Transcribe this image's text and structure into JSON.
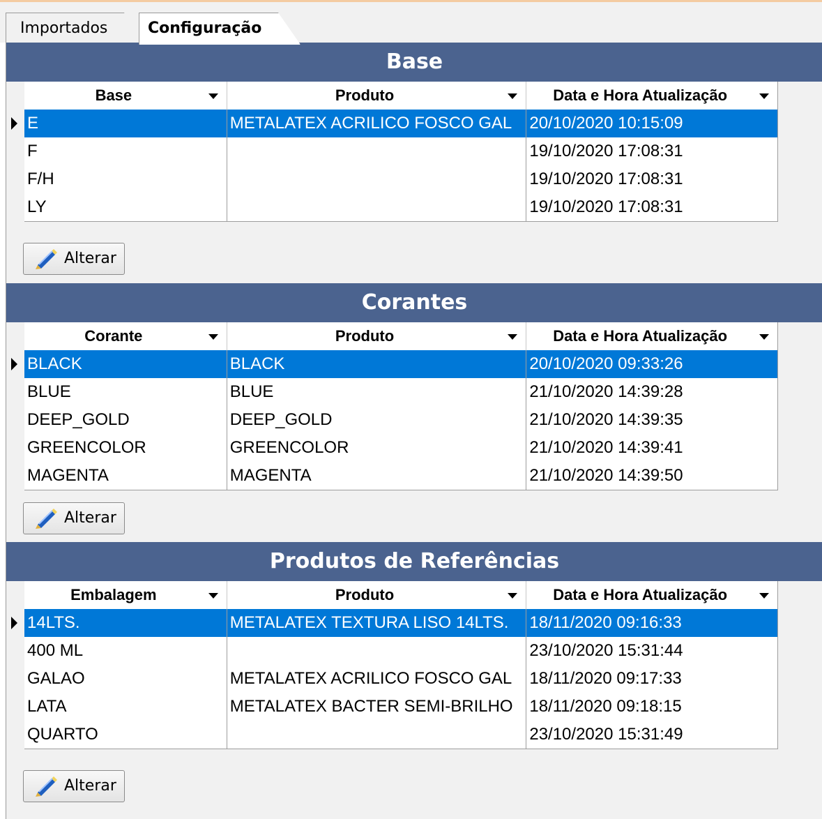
{
  "tabs": [
    {
      "label": "Importados",
      "active": false
    },
    {
      "label": "Configuração",
      "active": true
    }
  ],
  "sections": [
    {
      "title": "Base",
      "columns": [
        "Base",
        "Produto",
        "Data e Hora Atualização"
      ],
      "rows": [
        {
          "c1": "E",
          "c2": "METALATEX ACRILICO FOSCO GAL",
          "c3": "20/10/2020 10:15:09",
          "selected": true
        },
        {
          "c1": "F",
          "c2": "",
          "c3": "19/10/2020 17:08:31",
          "selected": false
        },
        {
          "c1": "F/H",
          "c2": "",
          "c3": "19/10/2020 17:08:31",
          "selected": false
        },
        {
          "c1": "LY",
          "c2": "",
          "c3": "19/10/2020 17:08:31",
          "selected": false
        }
      ],
      "button": "Alterar"
    },
    {
      "title": "Corantes",
      "columns": [
        "Corante",
        "Produto",
        "Data e Hora Atualização"
      ],
      "rows": [
        {
          "c1": "BLACK",
          "c2": "BLACK",
          "c3": "20/10/2020 09:33:26",
          "selected": true
        },
        {
          "c1": "BLUE",
          "c2": "BLUE",
          "c3": "21/10/2020 14:39:28",
          "selected": false
        },
        {
          "c1": "DEEP_GOLD",
          "c2": "DEEP_GOLD",
          "c3": "21/10/2020 14:39:35",
          "selected": false
        },
        {
          "c1": "GREENCOLOR",
          "c2": "GREENCOLOR",
          "c3": "21/10/2020 14:39:41",
          "selected": false
        },
        {
          "c1": "MAGENTA",
          "c2": "MAGENTA",
          "c3": "21/10/2020 14:39:50",
          "selected": false
        }
      ],
      "button": "Alterar"
    },
    {
      "title": "Produtos de Referências",
      "columns": [
        "Embalagem",
        "Produto",
        "Data e Hora Atualização"
      ],
      "rows": [
        {
          "c1": "14LTS.",
          "c2": "METALATEX TEXTURA LISO 14LTS.",
          "c3": "18/11/2020 09:16:33",
          "selected": true
        },
        {
          "c1": "400 ML",
          "c2": "",
          "c3": "23/10/2020 15:31:44",
          "selected": false
        },
        {
          "c1": "GALAO",
          "c2": "METALATEX ACRILICO FOSCO GAL",
          "c3": "18/11/2020 09:17:33",
          "selected": false
        },
        {
          "c1": "LATA",
          "c2": "METALATEX BACTER SEMI-BRILHO",
          "c3": "18/11/2020 09:18:15",
          "selected": false
        },
        {
          "c1": "QUARTO",
          "c2": "",
          "c3": "23/10/2020 15:31:49",
          "selected": false
        }
      ],
      "button": "Alterar"
    }
  ],
  "colors": {
    "header_bg": "#4b638f",
    "selection": "#0078d7",
    "panel_bg": "#f1f1f1"
  },
  "icons": {
    "alterar_button": "pencil-icon",
    "row_indicator": "row-pointer-icon",
    "column_dropdown": "dropdown-arrow-icon"
  }
}
